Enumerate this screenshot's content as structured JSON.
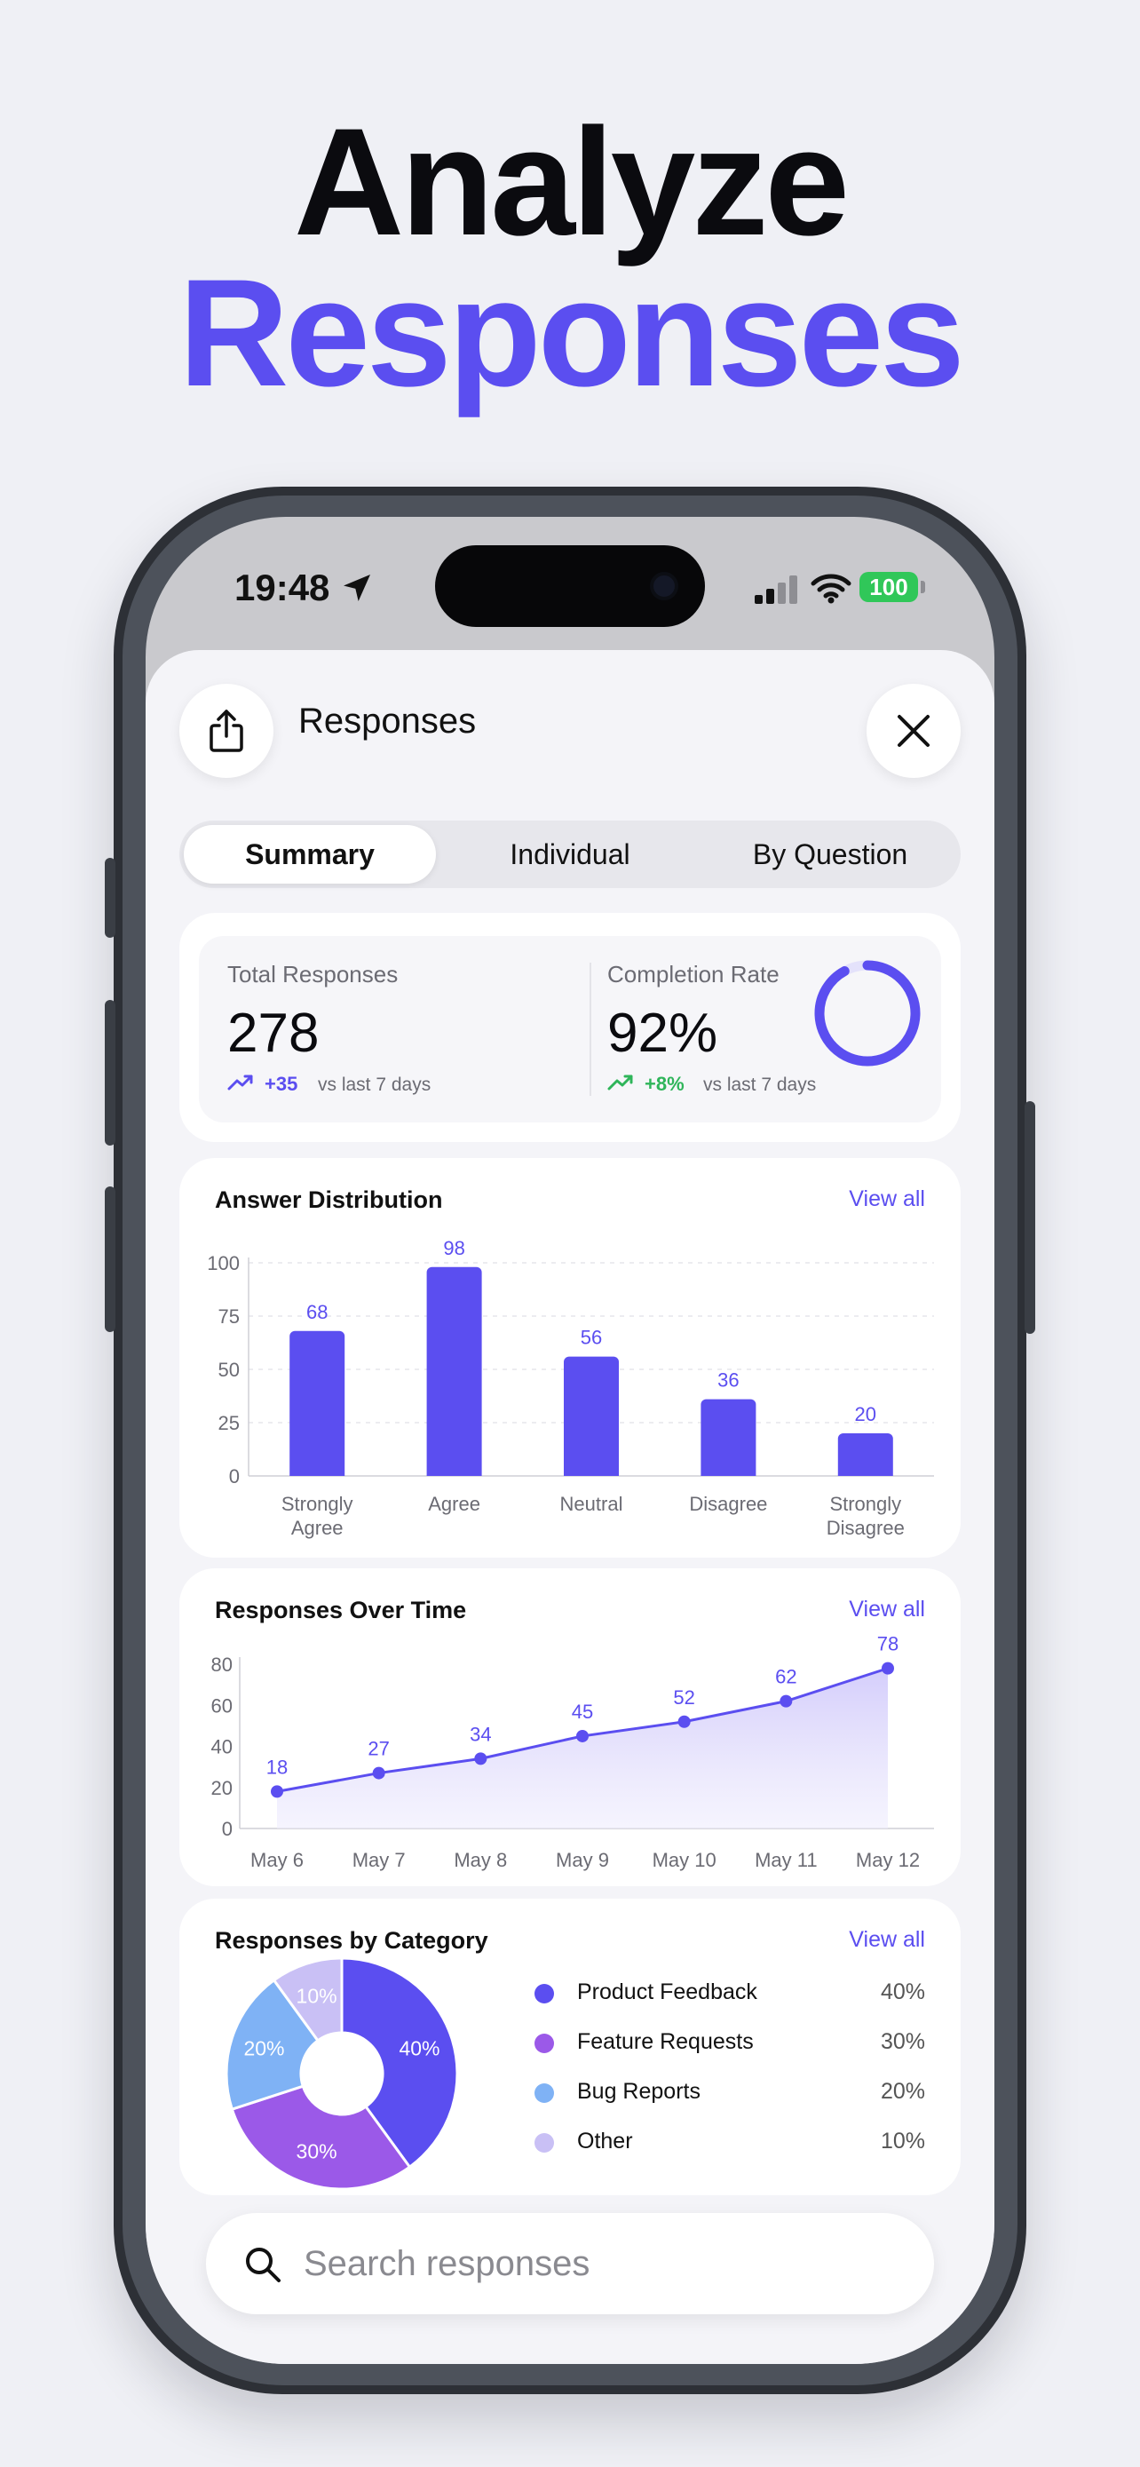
{
  "hero": {
    "line1": "Analyze",
    "line2": "Responses"
  },
  "status_bar": {
    "time": "19:48",
    "battery": "100"
  },
  "header": {
    "title": "Responses"
  },
  "tabs": [
    {
      "label": "Summary",
      "active": true
    },
    {
      "label": "Individual",
      "active": false
    },
    {
      "label": "By Question",
      "active": false
    }
  ],
  "stats": {
    "total": {
      "label": "Total Responses",
      "value": "278",
      "delta": "+35",
      "sub": "vs last 7 days"
    },
    "completion": {
      "label": "Completion Rate",
      "value": "92%",
      "delta": "+8%",
      "sub": "vs last 7 days",
      "ring_fraction": 0.92
    }
  },
  "answer_distribution": {
    "title": "Answer Distribution",
    "view_all": "View all"
  },
  "responses_over_time": {
    "title": "Responses Over Time",
    "view_all": "View all"
  },
  "responses_by_category": {
    "title": "Responses by Category",
    "view_all": "View all",
    "legend": [
      {
        "label": "Product Feedback",
        "pct": "40%",
        "color": "#5b4ef0"
      },
      {
        "label": "Feature Requests",
        "pct": "30%",
        "color": "#9b59e8"
      },
      {
        "label": "Bug Reports",
        "pct": "20%",
        "color": "#7fb2f5"
      },
      {
        "label": "Other",
        "pct": "10%",
        "color": "#c9c0f5"
      }
    ]
  },
  "search": {
    "placeholder": "Search responses"
  },
  "colors": {
    "accent": "#5b4ef0",
    "positive": "#2fb55a",
    "background": "#eff0f5"
  },
  "chart_data": [
    {
      "type": "bar",
      "title": "Answer Distribution",
      "categories": [
        [
          "Strongly",
          "Agree"
        ],
        [
          "Agree"
        ],
        [
          "Neutral"
        ],
        [
          "Disagree"
        ],
        [
          "Strongly",
          "Disagree"
        ]
      ],
      "values": [
        68,
        98,
        56,
        36,
        20
      ],
      "ylim": [
        0,
        100
      ],
      "yticks": [
        0,
        25,
        50,
        75,
        100
      ],
      "grid": true,
      "color": "#5b4ef0"
    },
    {
      "type": "area",
      "title": "Responses Over Time",
      "x": [
        "May 6",
        "May 7",
        "May 8",
        "May 9",
        "May 10",
        "May 11",
        "May 12"
      ],
      "values": [
        18,
        27,
        34,
        45,
        52,
        62,
        78
      ],
      "ylim": [
        0,
        80
      ],
      "yticks": [
        0,
        20,
        40,
        60,
        80
      ],
      "grid": false,
      "color": "#5b4ef0"
    },
    {
      "type": "pie",
      "title": "Responses by Category",
      "donut": true,
      "categories": [
        "Product Feedback",
        "Feature Requests",
        "Bug Reports",
        "Other"
      ],
      "values": [
        40,
        30,
        20,
        10
      ],
      "colors": [
        "#5b4ef0",
        "#9b59e8",
        "#7fb2f5",
        "#c9c0f5"
      ]
    }
  ]
}
